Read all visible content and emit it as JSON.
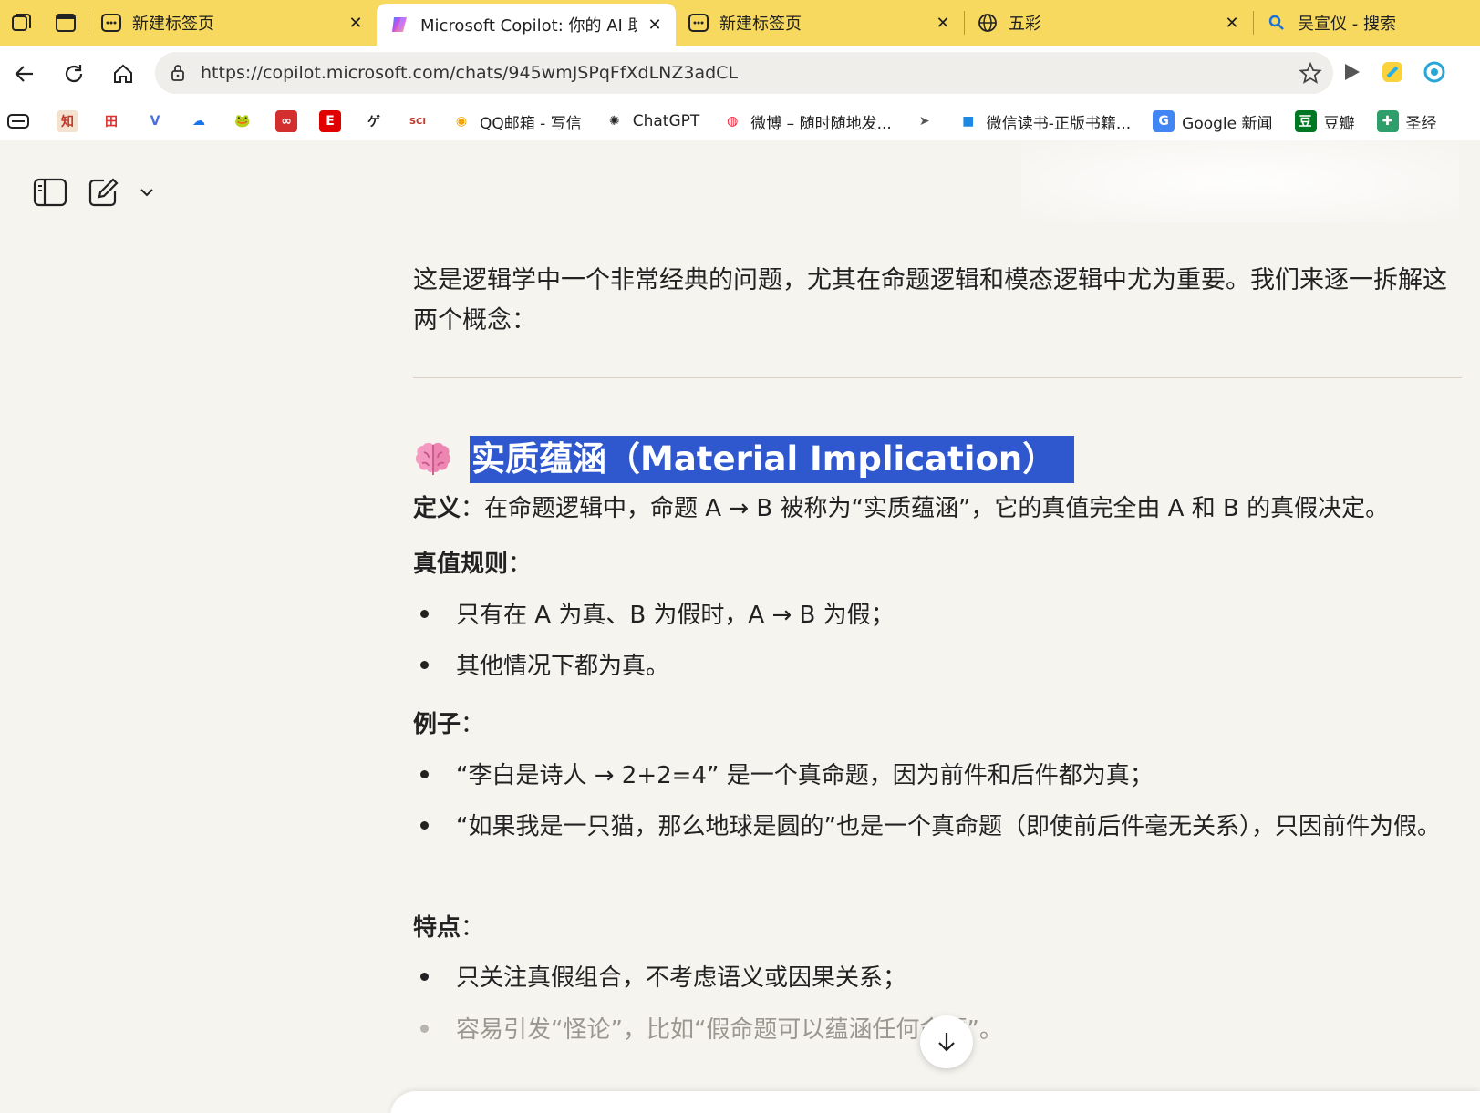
{
  "tabs": [
    {
      "title": "新建标签页",
      "icon": "new-tab-icon",
      "active": false
    },
    {
      "title": "Microsoft Copilot: 你的 AI 助手",
      "icon": "copilot-icon",
      "active": true
    },
    {
      "title": "新建标签页",
      "icon": "new-tab-icon",
      "active": false
    },
    {
      "title": "五彩",
      "icon": "globe-icon",
      "active": false
    },
    {
      "title": "吴宣仪 - 搜索",
      "icon": "search-icon",
      "active": false
    }
  ],
  "address_bar": {
    "url": "https://copilot.microsoft.com/chats/945wmJSPqFfXdLNZ3adCL"
  },
  "bookmarks": [
    {
      "label": "",
      "icon_text": "知",
      "color": "#c0392b"
    },
    {
      "label": "",
      "icon_text": "田",
      "color": "#e03030"
    },
    {
      "label": "",
      "icon_text": "V",
      "color": "#4a6ee0"
    },
    {
      "label": "",
      "icon_text": "☁",
      "color": "#1a73e8"
    },
    {
      "label": "",
      "icon_text": "🐸",
      "color": "#6aa84f"
    },
    {
      "label": "",
      "icon_text": "∞",
      "color": "#d32f2f"
    },
    {
      "label": "",
      "icon_text": "E",
      "color": "#e00000"
    },
    {
      "label": "",
      "icon_text": "ゲ",
      "color": "#222222"
    },
    {
      "label": "",
      "icon_text": "SCI",
      "color": "#c0392b"
    },
    {
      "label": "QQ邮箱 - 写信",
      "icon_text": "◉",
      "color": "#f4a300"
    },
    {
      "label": "ChatGPT",
      "icon_text": "✺",
      "color": "#222222"
    },
    {
      "label": "微博 – 随时随地发...",
      "icon_text": "◍",
      "color": "#e6162d"
    },
    {
      "label": "",
      "icon_text": "➤",
      "color": "#555555"
    },
    {
      "label": "微信读书-正版书籍...",
      "icon_text": "■",
      "color": "#1e88e5"
    },
    {
      "label": "Google 新闻",
      "icon_text": "G",
      "color": "#4285f4"
    },
    {
      "label": "豆瓣",
      "icon_text": "豆",
      "color": "#007722"
    },
    {
      "label": "圣经",
      "icon_text": "✚",
      "color": "#2e9e6b"
    }
  ],
  "chat": {
    "intro": "这是逻辑学中一个非常经典的问题，尤其在命题逻辑和模态逻辑中尤为重要。我们来逐一拆解这两个概念：",
    "heading": "实质蕴涵（Material Implication）",
    "definition_label": "定义",
    "definition_text": "：在命题逻辑中，命题 A → B 被称为“实质蕴涵”，它的真值完全由 A 和 B 的真假决定。",
    "truth_label": "真值规则",
    "truth_colon": "：",
    "truth_items": [
      "只有在 A 为真、B 为假时，A → B 为假；",
      "其他情况下都为真。"
    ],
    "example_label": "例子",
    "example_colon": "：",
    "example_items": [
      "“李白是诗人 → 2+2=4” 是一个真命题，因为前件和后件都为真；",
      "“如果我是一只猫，那么地球是圆的”也是一个真命题（即使前后件毫无关系），只因前件为假。"
    ],
    "feature_label": "特点",
    "feature_colon": "：",
    "feature_items": [
      "只关注真假组合，不考虑语义或因果关系；",
      "容易引发“怪论”，比如“假命题可以蕴涵任何命题”。"
    ]
  },
  "colors": {
    "tab_strip": "#f7d960",
    "highlight": "#2f58cf",
    "page_bg": "#f6f4ef"
  }
}
